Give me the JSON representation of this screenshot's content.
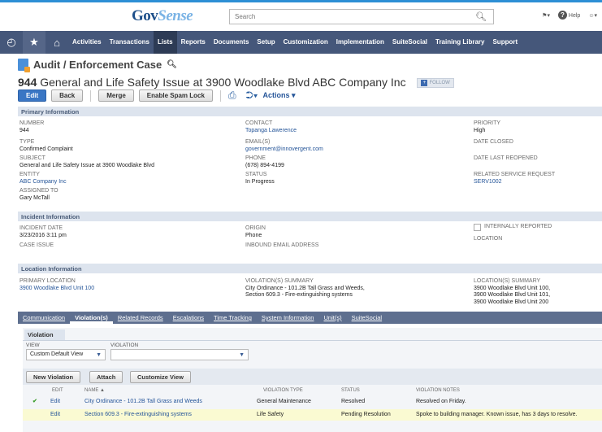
{
  "brand": {
    "name_a": "Gov",
    "name_b": "Sense"
  },
  "search": {
    "placeholder": "Search"
  },
  "top": {
    "help": "Help"
  },
  "nav": {
    "items": [
      "Activities",
      "Transactions",
      "Lists",
      "Reports",
      "Documents",
      "Setup",
      "Customization",
      "Implementation",
      "SuiteSocial",
      "Training Library",
      "Support"
    ],
    "active": "Lists"
  },
  "record": {
    "type": "Audit / Enforcement Case",
    "number": "944",
    "title": "General and Life Safety Issue at 3900 Woodlake Blvd ABC Company Inc",
    "follow": "FOLLOW"
  },
  "buttons": {
    "edit": "Edit",
    "back": "Back",
    "merge": "Merge",
    "spam": "Enable Spam Lock",
    "actions": "Actions"
  },
  "primary": {
    "heading": "Primary Information",
    "number_label": "NUMBER",
    "number": "944",
    "type_label": "TYPE",
    "type": "Confirmed Complaint",
    "subject_label": "SUBJECT",
    "subject": "General and Life Safety Issue at 3900 Woodlake Blvd",
    "entity_label": "ENTITY",
    "entity": "ABC Company Inc",
    "assigned_label": "ASSIGNED TO",
    "assigned": "Gary McTall",
    "contact_label": "CONTACT",
    "contact": "Topanga Lawerence",
    "email_label": "EMAIL(S)",
    "email": "government@innovergent.com",
    "phone_label": "PHONE",
    "phone": "(678) 894-4199",
    "status_label": "STATUS",
    "status": "In Progress",
    "priority_label": "PRIORITY",
    "priority": "High",
    "closed_label": "DATE CLOSED",
    "reopened_label": "DATE LAST REOPENED",
    "related_label": "RELATED SERVICE REQUEST",
    "related": "SERV1002"
  },
  "incident": {
    "heading": "Incident Information",
    "date_label": "INCIDENT DATE",
    "date": "3/23/2016 3:11 pm",
    "issue_label": "CASE ISSUE",
    "origin_label": "ORIGIN",
    "origin": "Phone",
    "inbound_label": "INBOUND EMAIL ADDRESS",
    "internal_label": "INTERNALLY REPORTED",
    "location_label": "LOCATION"
  },
  "location": {
    "heading": "Location Information",
    "primary_label": "PRIMARY LOCATION",
    "primary": "3900 Woodlake Blvd Unit 100",
    "violation_label": "VIOLATION(S) SUMMARY",
    "violation_1": "City Ordinance - 101.2B Tall Grass and Weeds,",
    "violation_2": "Section 609.3 - Fire-extinguishing systems",
    "locsum_label": "LOCATION(S) SUMMARY",
    "locsum_1": "3900 Woodlake Blvd Unit 100,",
    "locsum_2": "3900 Woodlake Blvd Unit 101,",
    "locsum_3": "3900 Woodlake Blvd Unit 200"
  },
  "subtabs": [
    "Communication",
    "Violation(s)",
    "Related Records",
    "Escalations",
    "Time Tracking",
    "System Information",
    "Unit(s)",
    "SuiteSocial"
  ],
  "violation_panel": {
    "tab": "Violation",
    "view_label": "VIEW",
    "view_value": "Custom Default View",
    "violation_label": "VIOLATION",
    "btn_new": "New Violation",
    "btn_attach": "Attach",
    "btn_customize": "Customize View",
    "columns": [
      "EDIT",
      "NAME ▲",
      "VIOLATION TYPE",
      "STATUS",
      "VIOLATION NOTES"
    ],
    "rows": [
      {
        "check": "✔",
        "edit": "Edit",
        "name": "City Ordinance - 101.2B Tall Grass and Weeds",
        "type": "General Maintenance",
        "status": "Resolved",
        "notes": "Resolved on Friday."
      },
      {
        "check": "",
        "edit": "Edit",
        "name": "Section 609.3 - Fire-extinguishing systems",
        "type": "Life Safety",
        "status": "Pending Resolution",
        "notes": "Spoke to building manager. Known issue, has 3 days to resolve."
      }
    ]
  }
}
